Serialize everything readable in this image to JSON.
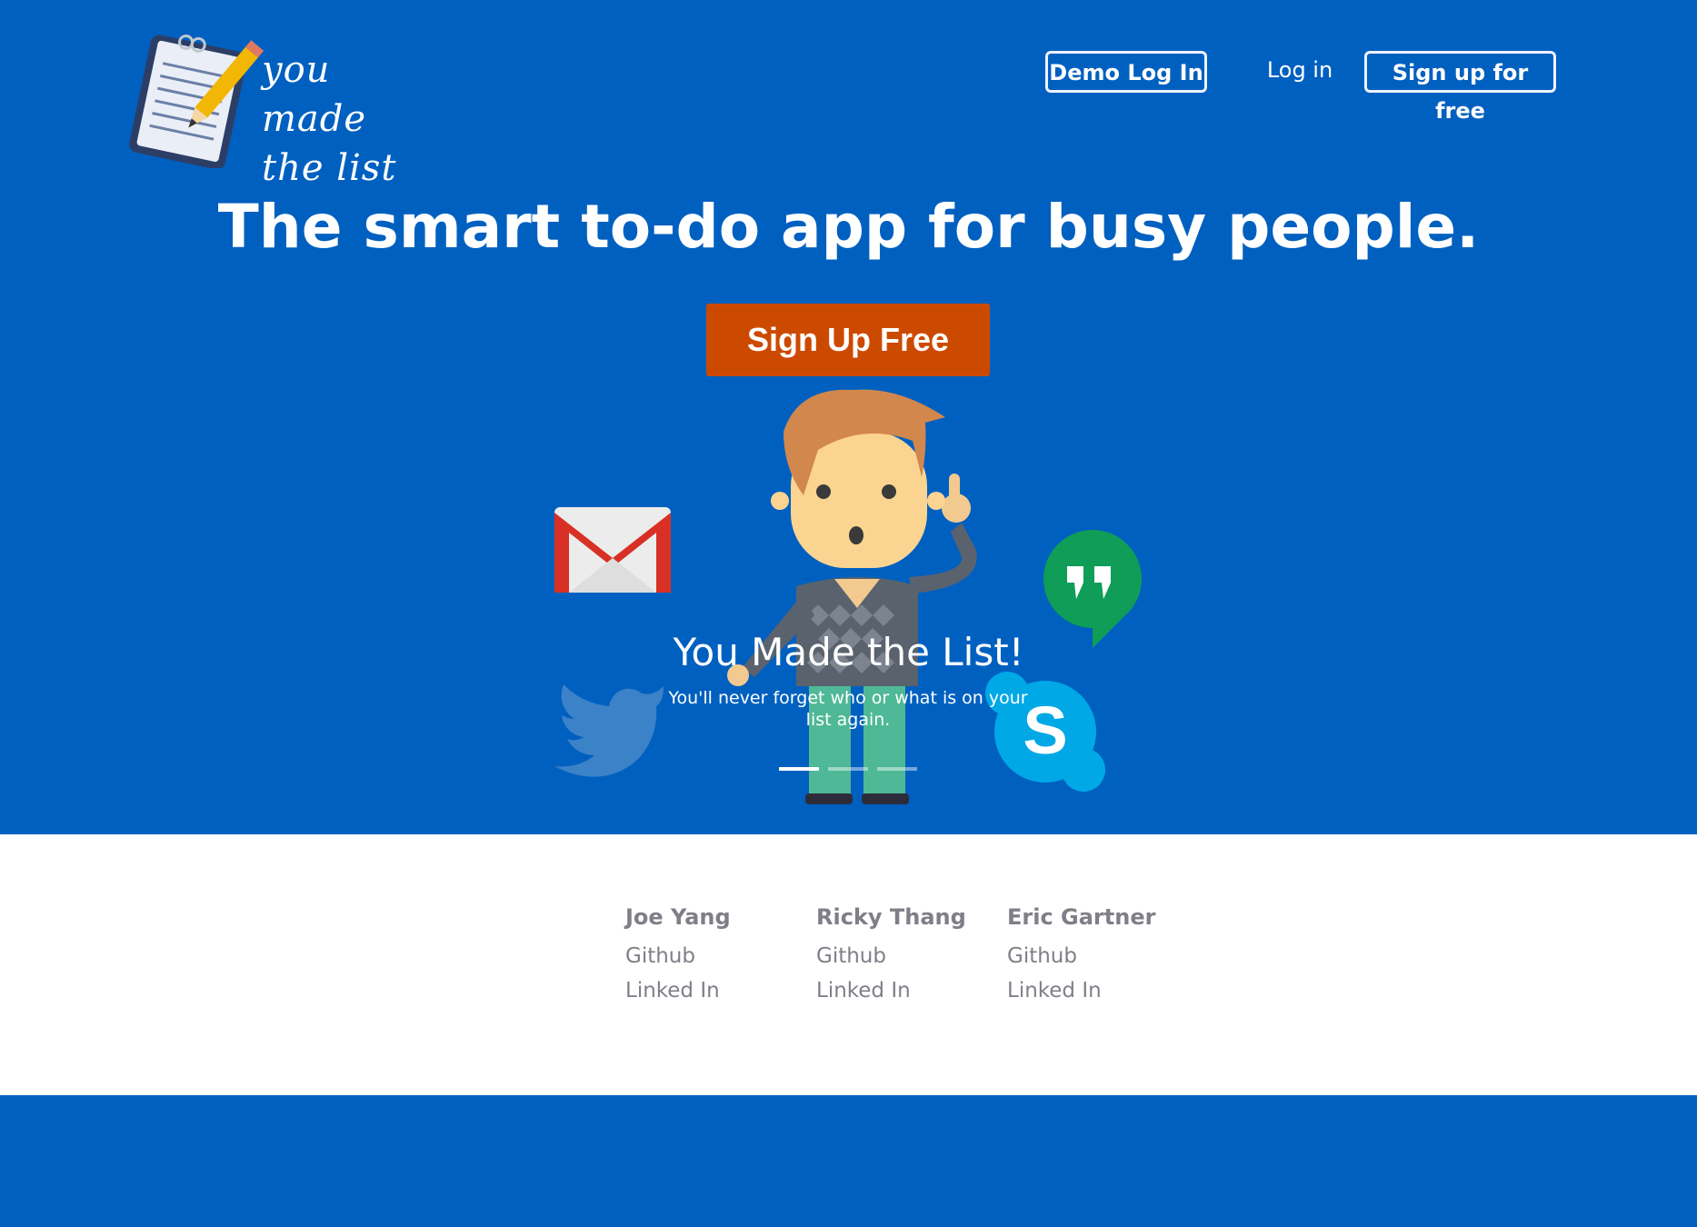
{
  "header": {
    "logo_text": "you made\nthe list",
    "demo_login": "Demo Log In",
    "login": "Log in",
    "signup": "Sign up for free"
  },
  "hero": {
    "headline": "The smart to-do app for busy people.",
    "cta": "Sign Up Free"
  },
  "carousel": {
    "title": "You Made the List!",
    "description": "You'll never forget who or what is on your list again.",
    "active_index": 0,
    "slide_count": 3
  },
  "icons": [
    "notepad-pencil-icon",
    "gmail-icon",
    "hangouts-icon",
    "twitter-icon",
    "skype-icon"
  ],
  "team": [
    {
      "name": "Joe Yang",
      "github": "Github",
      "linkedin": "Linked In"
    },
    {
      "name": "Ricky Thang",
      "github": "Github",
      "linkedin": "Linked In"
    },
    {
      "name": "Eric Gartner",
      "github": "Github",
      "linkedin": "Linked In"
    }
  ],
  "colors": {
    "brand_blue": "#0060c0",
    "cta_orange": "#cc4a00",
    "footer_text": "#7f7f88"
  }
}
